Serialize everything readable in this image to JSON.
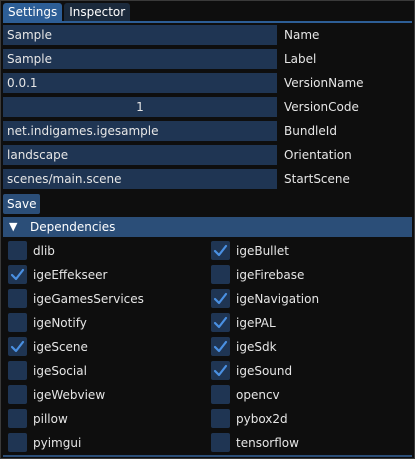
{
  "tabs": [
    {
      "label": "Settings",
      "active": true
    },
    {
      "label": "Inspector",
      "active": false
    }
  ],
  "fields": [
    {
      "value": "Sample",
      "label": "Name"
    },
    {
      "value": "Sample",
      "label": "Label"
    },
    {
      "value": "0.0.1",
      "label": "VersionName"
    },
    {
      "value": "1",
      "label": "VersionCode"
    },
    {
      "value": "net.indigames.igesample",
      "label": "BundleId"
    },
    {
      "value": "landscape",
      "label": "Orientation"
    },
    {
      "value": "scenes/main.scene",
      "label": "StartScene"
    }
  ],
  "save_label": "Save",
  "dependencies": {
    "title": "Dependencies",
    "items": [
      {
        "name": "dlib",
        "checked": false
      },
      {
        "name": "igeBullet",
        "checked": true
      },
      {
        "name": "igeEffekseer",
        "checked": true
      },
      {
        "name": "igeFirebase",
        "checked": false
      },
      {
        "name": "igeGamesServices",
        "checked": false
      },
      {
        "name": "igeNavigation",
        "checked": true
      },
      {
        "name": "igeNotify",
        "checked": false
      },
      {
        "name": "igePAL",
        "checked": true
      },
      {
        "name": "igeScene",
        "checked": true
      },
      {
        "name": "igeSdk",
        "checked": true
      },
      {
        "name": "igeSocial",
        "checked": false
      },
      {
        "name": "igeSound",
        "checked": true
      },
      {
        "name": "igeWebview",
        "checked": false
      },
      {
        "name": "opencv",
        "checked": false
      },
      {
        "name": "pillow",
        "checked": false
      },
      {
        "name": "pybox2d",
        "checked": false
      },
      {
        "name": "pyimgui",
        "checked": false
      },
      {
        "name": "tensorflow",
        "checked": false
      }
    ]
  },
  "colors": {
    "accent": "#2d5e96",
    "input_bg": "#1f3553",
    "checkmark": "#4a90e2"
  }
}
